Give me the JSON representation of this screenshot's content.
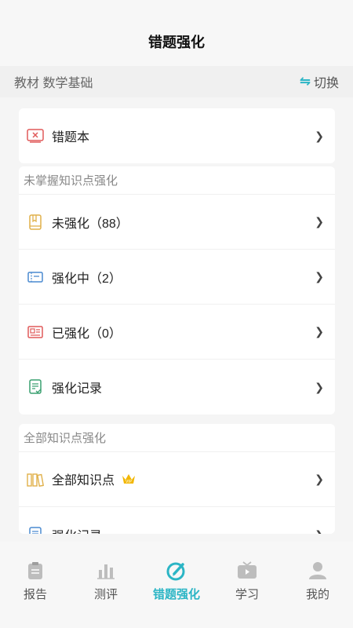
{
  "header": {
    "title": "错题强化"
  },
  "subbar": {
    "textbook": "教材 数学基础",
    "switch_label": "切换",
    "switch_icon": "⇋"
  },
  "wrongbook": {
    "label": "错题本"
  },
  "section1": {
    "title": "未掌握知识点强化",
    "items": [
      {
        "label": "未强化（88）",
        "icon": "book-icon"
      },
      {
        "label": "强化中（2）",
        "icon": "ticket-icon"
      },
      {
        "label": "已强化（0）",
        "icon": "id-card-icon"
      },
      {
        "label": "强化记录",
        "icon": "record-icon"
      }
    ]
  },
  "section2": {
    "title": "全部知识点强化",
    "items": [
      {
        "label": "全部知识点",
        "icon": "books-icon",
        "badge": "VIP"
      },
      {
        "label": "强化记录",
        "icon": "record-icon"
      }
    ]
  },
  "tabs": [
    {
      "label": "报告",
      "active": false
    },
    {
      "label": "测评",
      "active": false
    },
    {
      "label": "错题强化",
      "active": true
    },
    {
      "label": "学习",
      "active": false
    },
    {
      "label": "我的",
      "active": false
    }
  ],
  "colors": {
    "accent": "#2bb5c5",
    "red": "#e05a5a",
    "gold": "#e0b04a"
  }
}
